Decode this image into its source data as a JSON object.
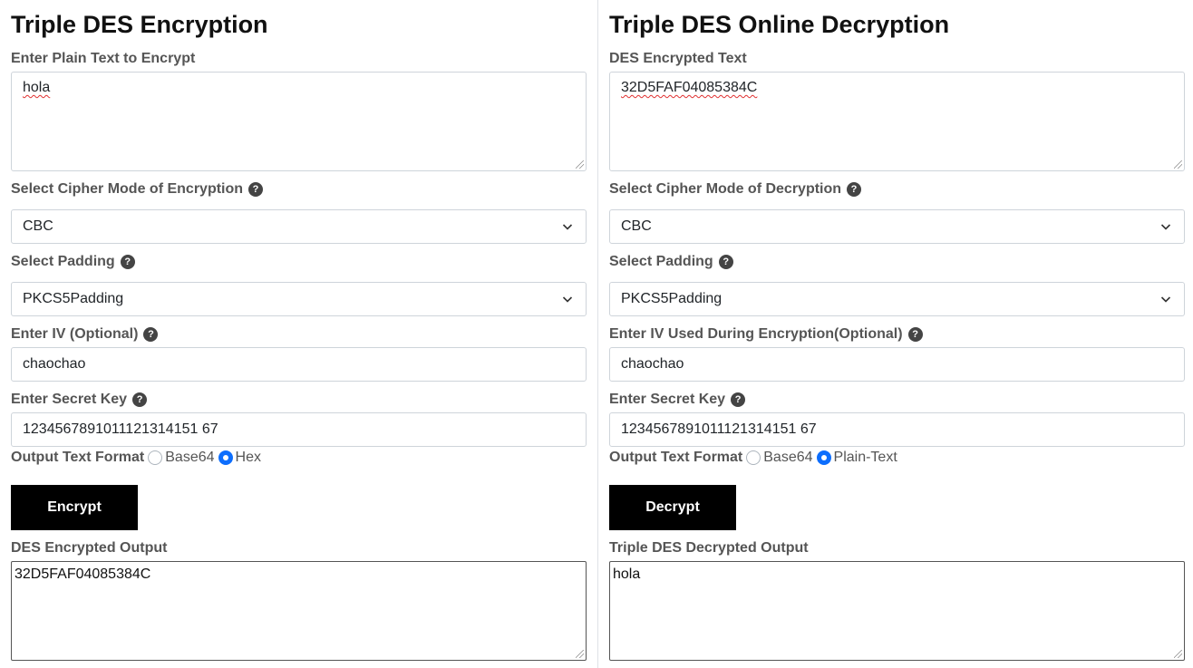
{
  "encrypt": {
    "title": "Triple DES Encryption",
    "plain_text_label": "Enter Plain Text to Encrypt",
    "plain_text_value": "hola",
    "cipher_mode_label": "Select Cipher Mode of Encryption",
    "cipher_mode_value": "CBC",
    "padding_label": "Select Padding",
    "padding_value": "PKCS5Padding",
    "iv_label": "Enter IV (Optional)",
    "iv_value": "chaochao",
    "secret_key_label": "Enter Secret Key",
    "secret_key_value": "1234567891011121314151 67",
    "output_format_label": "Output Text Format",
    "output_format_options": [
      "Base64",
      "Hex"
    ],
    "output_format_selected": "Hex",
    "button_label": "Encrypt",
    "output_label": "DES Encrypted Output",
    "output_value": "32D5FAF04085384C"
  },
  "decrypt": {
    "title": "Triple DES Online Decryption",
    "encrypted_text_label": "DES Encrypted Text",
    "encrypted_text_value": "32D5FAF04085384C",
    "cipher_mode_label": "Select Cipher Mode of Decryption",
    "cipher_mode_value": "CBC",
    "padding_label": "Select Padding",
    "padding_value": "PKCS5Padding",
    "iv_label": "Enter IV Used During Encryption(Optional)",
    "iv_value": "chaochao",
    "secret_key_label": "Enter Secret Key",
    "secret_key_value": "1234567891011121314151 67",
    "output_format_label": "Output Text Format",
    "output_format_options": [
      "Base64",
      "Plain-Text"
    ],
    "output_format_selected": "Plain-Text",
    "button_label": "Decrypt",
    "output_label": "Triple DES Decrypted Output",
    "output_value": "hola"
  },
  "icons": {
    "help": "question-circle-icon",
    "dropdown": "chevron-down-icon"
  },
  "colors": {
    "button_bg": "#000000",
    "radio_checked": "#0d6efd",
    "label": "#555555"
  }
}
